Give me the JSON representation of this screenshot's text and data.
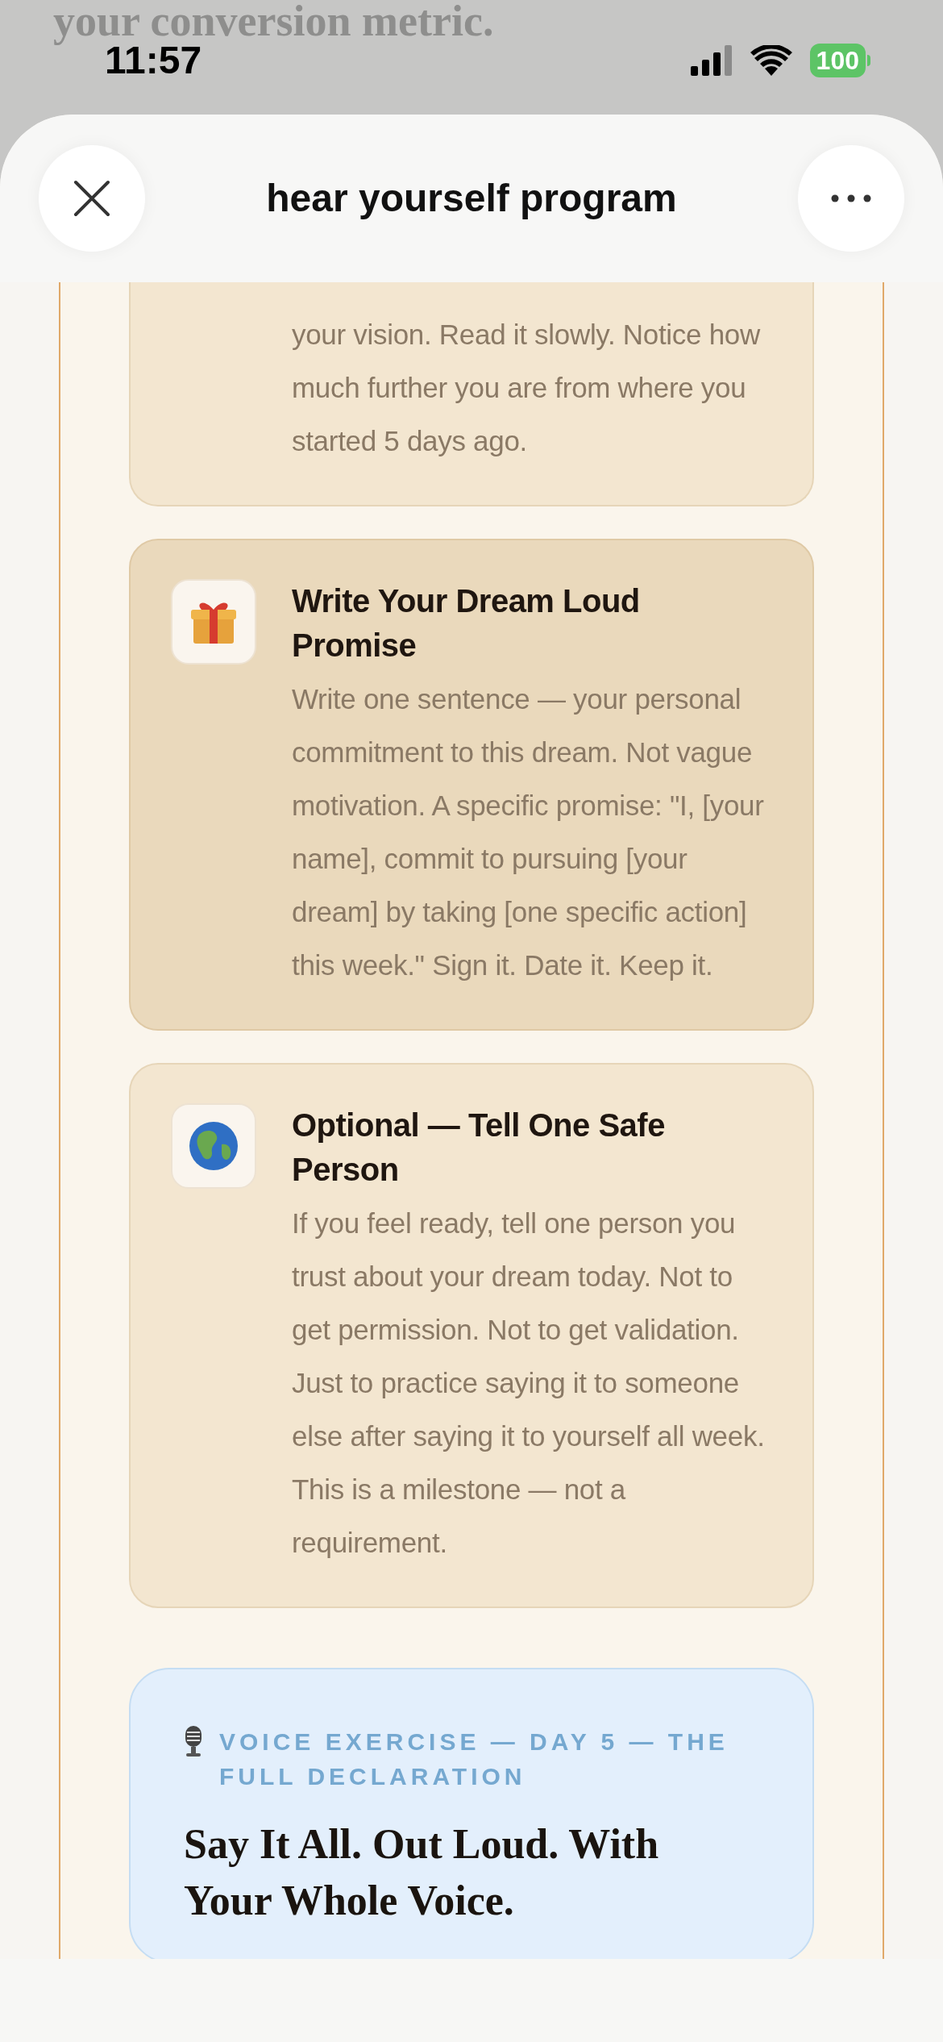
{
  "backdrop_text": "your conversion metric.",
  "status_bar": {
    "time": "11:57",
    "battery": "100"
  },
  "header": {
    "title": "hear yourself program"
  },
  "cards": [
    {
      "kind": "step",
      "highlighted": false,
      "body": "your vision. Read it slowly. Notice how much further you are from where you started 5 days ago."
    },
    {
      "kind": "step",
      "highlighted": true,
      "title": "Write Your Dream Loud Promise",
      "body": "Write one sentence — your personal commitment to this dream. Not vague motivation. A specific promise: \"I, [your name], commit to pursuing [your dream] by taking [one specific action] this week.\" Sign it. Date it. Keep it."
    },
    {
      "kind": "step",
      "highlighted": false,
      "title": "Optional — Tell One Safe Person",
      "body": "If you feel ready, tell one person you trust about your dream today. Not to get permission. Not to get validation. Just to practice saying it to someone else after saying it to yourself all week. This is a milestone — not a requirement."
    },
    {
      "kind": "exercise",
      "label": "VOICE EXERCISE — DAY 5 — THE FULL DECLARATION",
      "title": "Say It All. Out Loud. With Your Whole Voice."
    }
  ]
}
